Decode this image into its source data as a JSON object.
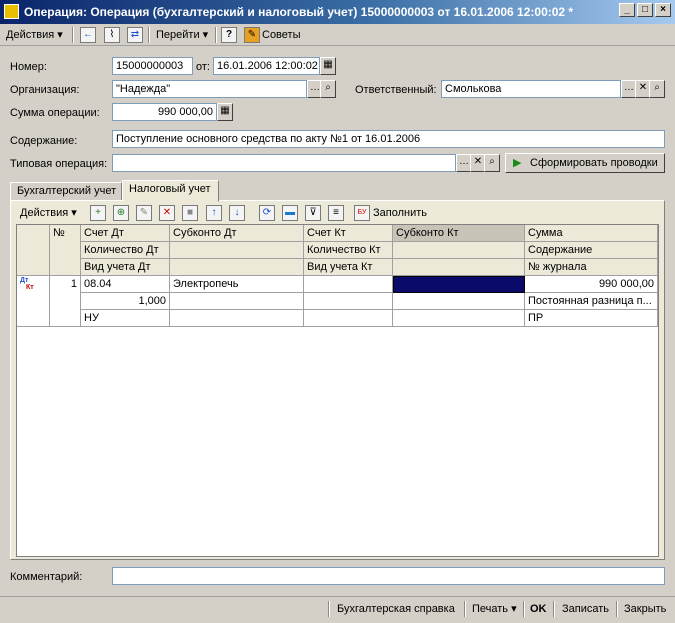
{
  "window": {
    "title": "Операция: Операция (бухгалтерский и налоговый учет) 15000000003 от 16.01.2006 12:00:02 *"
  },
  "toolbar": {
    "actions": "Действия",
    "goto": "Перейти",
    "help": "?",
    "tips": "Советы"
  },
  "form": {
    "number_label": "Номер:",
    "number_value": "15000000003",
    "date_label": "от:",
    "date_value": "16.01.2006 12:00:02",
    "org_label": "Организация:",
    "org_value": "\"Надежда\"",
    "resp_label": "Ответственный:",
    "resp_value": "Смолькова",
    "sum_label": "Сумма операции:",
    "sum_value": "990 000,00",
    "content_label": "Содержание:",
    "content_value": "Поступление основного средства по акту №1 от 16.01.2006",
    "typical_label": "Типовая операция:",
    "typical_value": "",
    "generate_button": "Сформировать проводки"
  },
  "tabs": [
    "Бухгалтерский учет",
    "Налоговый учет"
  ],
  "inner_toolbar": {
    "actions": "Действия",
    "fill": "Заполнить"
  },
  "table": {
    "headers": [
      [
        "№",
        "Счет Дт",
        "Субконто Дт",
        "Счет Кт",
        "Субконто Кт",
        "Сумма"
      ],
      [
        "",
        "Количество Дт",
        "",
        "Количество Кт",
        "",
        "Содержание"
      ],
      [
        "",
        "Вид учета Дт",
        "",
        "Вид учета Кт",
        "",
        "№ журнала"
      ]
    ],
    "row": {
      "icon_dt": "Дт",
      "icon_kt": "Кт",
      "num": "1",
      "line1": [
        "08.04",
        "Электропечь",
        "",
        "",
        "990 000,00"
      ],
      "line2": [
        "1,000",
        "",
        "",
        "",
        "Постоянная разница п..."
      ],
      "line3": [
        "НУ",
        "",
        "",
        "",
        "ПР"
      ]
    }
  },
  "comment": {
    "label": "Комментарий:",
    "value": ""
  },
  "bottom": {
    "report": "Бухгалтерская справка",
    "print": "Печать",
    "ok": "OK",
    "save": "Записать",
    "close": "Закрыть"
  },
  "colors": {
    "selected_cell": "#0a0a6a",
    "title_start": "#0a246a",
    "title_end": "#a6caf0"
  }
}
